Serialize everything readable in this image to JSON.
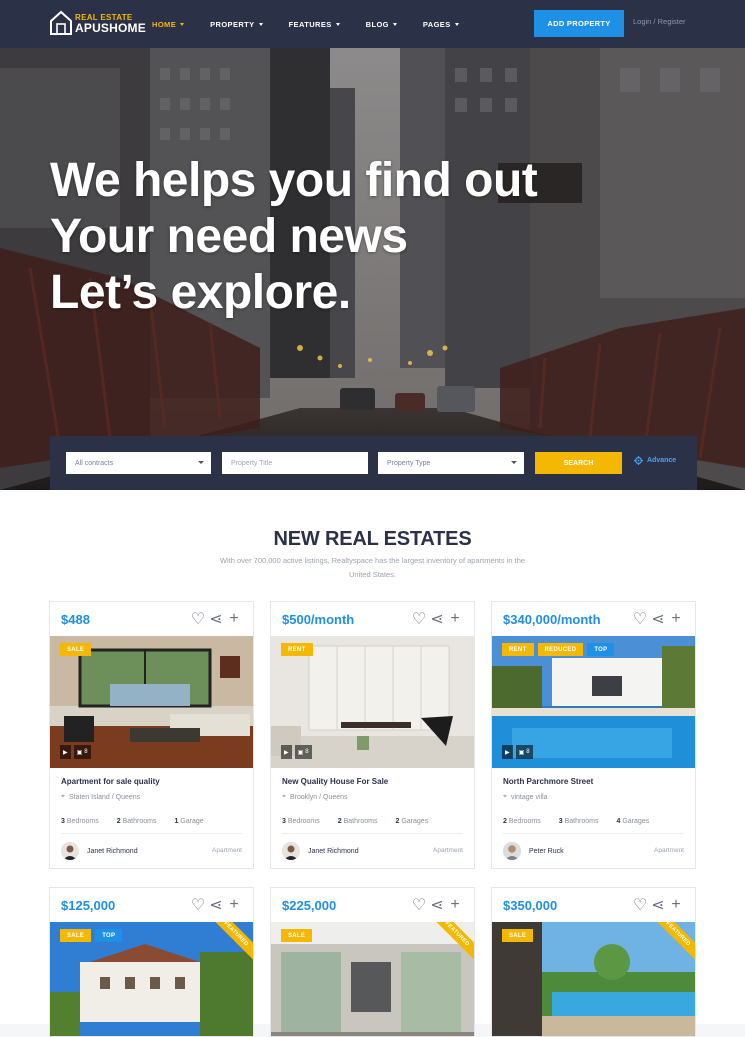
{
  "nav": {
    "logo_top": "REAL ESTATE",
    "logo_bottom": "APUSHOME",
    "menu": [
      {
        "label": "HOME",
        "active": true
      },
      {
        "label": "PROPERTY",
        "active": false
      },
      {
        "label": "FEATURES",
        "active": false
      },
      {
        "label": "BLOG",
        "active": false
      },
      {
        "label": "PAGES",
        "active": false
      }
    ],
    "add_property": "ADD PROPERTY",
    "login": "Login / Register"
  },
  "hero": {
    "line1": "We helps you find out",
    "line2": "Your need news",
    "line3": "Let’s explore."
  },
  "search": {
    "contracts": "All contracts",
    "title_placeholder": "Property Title",
    "type": "Property Type",
    "button": "SEARCH",
    "advance": "Advance"
  },
  "section": {
    "title": "NEW REAL ESTATES",
    "subtitle": "With over 700,000 active listings, Realtyspace has the largest inventory of apartments in the United States."
  },
  "cards": [
    {
      "price": "$488",
      "per": "",
      "badges": [
        "SALE"
      ],
      "videos": "",
      "photos": "8",
      "title": "Apartment for sale quality",
      "location": "Staten Island / Queens",
      "f1n": "3",
      "f1": "Bedrooms",
      "f2n": "2",
      "f2": "Bathrooms",
      "f3n": "1",
      "f3": "Garage",
      "agent": "Janet Richmond",
      "type": "Apartment"
    },
    {
      "price": "$500",
      "per": "/month",
      "badges": [
        "RENT"
      ],
      "videos": "",
      "photos": "8",
      "title": "New Quality House For Sale",
      "location": "Brooklyn / Queens",
      "f1n": "3",
      "f1": "Bedrooms",
      "f2n": "2",
      "f2": "Bathrooms",
      "f3n": "2",
      "f3": "Garages",
      "agent": "Janet Richmond",
      "type": "Apartment"
    },
    {
      "price": "$340,000",
      "per": "/month",
      "badges": [
        "RENT",
        "REDUCED",
        "TOP"
      ],
      "videos": "",
      "photos": "8",
      "title": "North Parchmore Street",
      "location": "vintage villa",
      "f1n": "2",
      "f1": "Bedrooms",
      "f2n": "3",
      "f2": "Bathrooms",
      "f3n": "4",
      "f3": "Garages",
      "agent": "Peter Ruck",
      "type": "Apartment"
    },
    {
      "price": "$125,000",
      "badges": [
        "SALE",
        "TOP"
      ],
      "featured": "FEATURED"
    },
    {
      "price": "$225,000",
      "badges": [
        "SALE"
      ],
      "featured": "FEATURED"
    },
    {
      "price": "$350,000",
      "badges": [
        "SALE"
      ],
      "featured": "FEATURED"
    }
  ],
  "colors": {
    "nav_bg": "#2b3247",
    "accent_yellow": "#f5b800",
    "accent_blue": "#1e90e6"
  }
}
